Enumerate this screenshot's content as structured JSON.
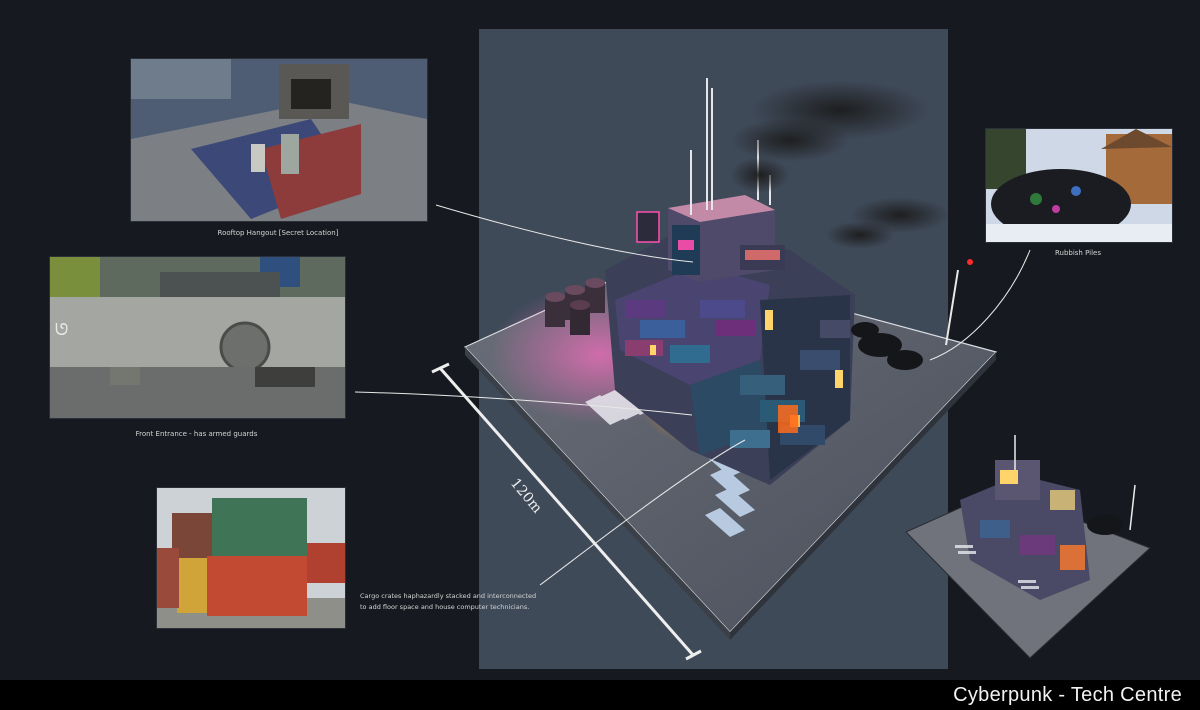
{
  "sheet_title": "Cyberpunk - Tech Centre",
  "captions": {
    "rooftop": "Rooftop Hangout [Secret Location]",
    "front": "Front Entrance - has armed guards",
    "rubbish": "Rubbish Piles",
    "cargo_line1": "Cargo crates haphazardly stacked and interconnected",
    "cargo_line2": "to add floor space and house computer technicians."
  },
  "measure_label": "120m",
  "colors": {
    "background": "#16191f",
    "center_panel": "#3f4a59",
    "neon_pink": "#ff4fb0",
    "neon_cyan": "#39e1ff",
    "warm_glow": "#ff9a2e"
  }
}
